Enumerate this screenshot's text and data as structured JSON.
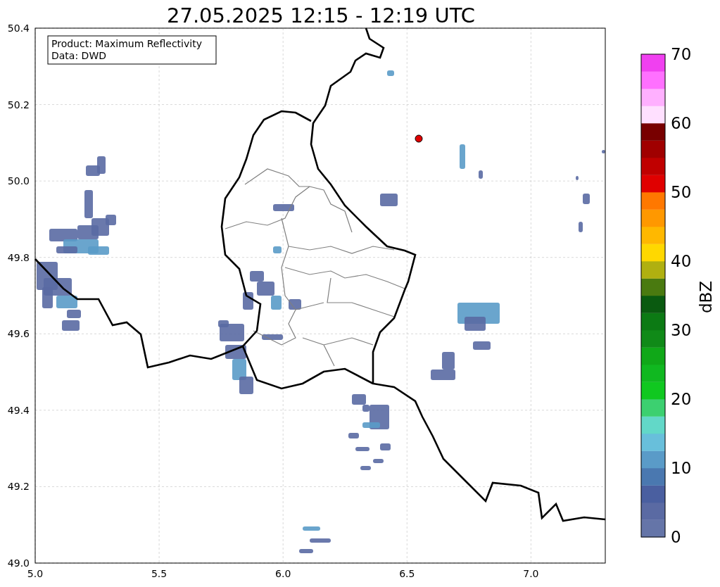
{
  "title": "27.05.2025 12:15 - 12:19 UTC",
  "info_box": {
    "lines": [
      "Product: Maximum Reflectivity",
      "Data: DWD"
    ]
  },
  "x_axis": {
    "ticks": [
      "5.0",
      "5.5",
      "6.0",
      "6.5",
      "7.0"
    ]
  },
  "y_axis": {
    "ticks": [
      "50.4",
      "50.2",
      "50.0",
      "49.8",
      "49.6",
      "49.4",
      "49.2",
      "49.0"
    ]
  },
  "colorbar": {
    "label": "dBZ",
    "ticks": [
      "70",
      "60",
      "50",
      "40",
      "30",
      "20",
      "10",
      "0"
    ],
    "segments": [
      {
        "color": "#6575a8"
      },
      {
        "color": "#5a6aa3"
      },
      {
        "color": "#4a5fa0"
      },
      {
        "color": "#4a78b0"
      },
      {
        "color": "#5a9bc8"
      },
      {
        "color": "#68bfdb"
      },
      {
        "color": "#62d8c8"
      },
      {
        "color": "#3cd070"
      },
      {
        "color": "#10c820"
      },
      {
        "color": "#10b820"
      },
      {
        "color": "#10a818"
      },
      {
        "color": "#108a18"
      },
      {
        "color": "#0c7a14"
      },
      {
        "color": "#0a5a10"
      },
      {
        "color": "#4a7a10"
      },
      {
        "color": "#b0b010"
      },
      {
        "color": "#ffd800"
      },
      {
        "color": "#ffb800"
      },
      {
        "color": "#ff9800"
      },
      {
        "color": "#ff7800"
      },
      {
        "color": "#e00000"
      },
      {
        "color": "#c00000"
      },
      {
        "color": "#a00000"
      },
      {
        "color": "#780000"
      },
      {
        "color": "#ffe0ff"
      },
      {
        "color": "#ffb0ff"
      },
      {
        "color": "#ff70ff"
      },
      {
        "color": "#f040f0"
      }
    ]
  }
}
